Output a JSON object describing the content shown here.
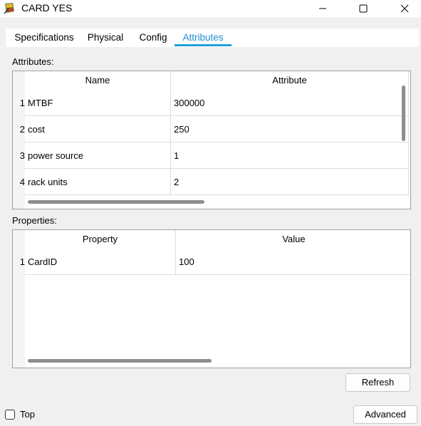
{
  "window": {
    "title": "CARD YES",
    "icon": "card-app-icon",
    "controls": [
      "minimize-icon",
      "maximize-icon",
      "close-icon"
    ]
  },
  "tabs": [
    {
      "label": "Specifications",
      "active": false
    },
    {
      "label": "Physical",
      "active": false
    },
    {
      "label": "Config",
      "active": false
    },
    {
      "label": "Attributes",
      "active": true
    }
  ],
  "attributes_section": {
    "label": "Attributes:",
    "columns": [
      "Name",
      "Attribute"
    ],
    "rows": [
      {
        "num": "1",
        "name": "MTBF",
        "value": "300000"
      },
      {
        "num": "2",
        "name": "cost",
        "value": "250"
      },
      {
        "num": "3",
        "name": "power source",
        "value": "1"
      },
      {
        "num": "4",
        "name": "rack units",
        "value": "2"
      }
    ]
  },
  "properties_section": {
    "label": "Properties:",
    "columns": [
      "Property",
      "Value"
    ],
    "rows": [
      {
        "num": "1",
        "name": "CardID",
        "value": "100"
      }
    ]
  },
  "buttons": {
    "refresh": "Refresh",
    "advanced": "Advanced"
  },
  "top_checkbox": {
    "label": "Top",
    "checked": false
  },
  "colors": {
    "accent": "#1fa0dd",
    "background": "#f0f0f0"
  }
}
